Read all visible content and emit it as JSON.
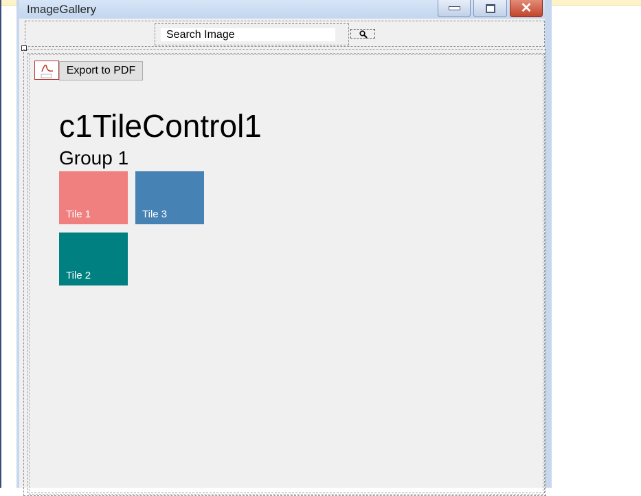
{
  "window": {
    "title": "ImageGallery"
  },
  "search": {
    "placeholder": "Search Image",
    "icon": "search-icon"
  },
  "toolbar": {
    "export_label": "Export to PDF",
    "export_icon": "pdf-icon"
  },
  "tile_control": {
    "title": "c1TileControl1",
    "group": "Group 1",
    "tiles": [
      {
        "label": "Tile 1",
        "color": "#f08080"
      },
      {
        "label": "Tile 3",
        "color": "#4682b4"
      },
      {
        "label": "Tile 2",
        "color": "#008080"
      }
    ]
  }
}
